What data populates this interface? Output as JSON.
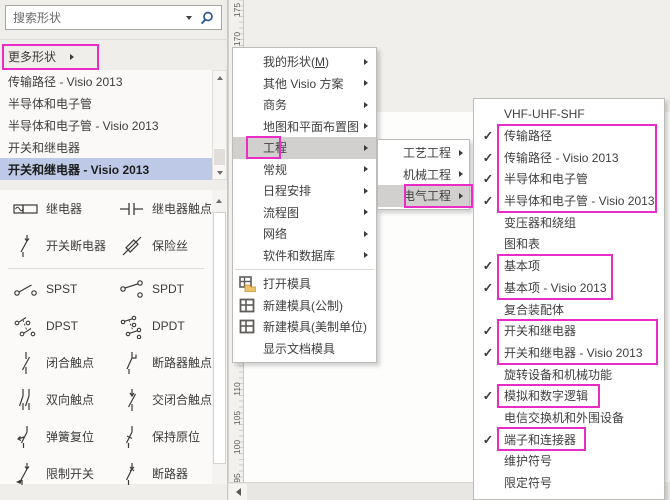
{
  "colors": {
    "annotation_magenta": "#ea2cc6",
    "selected_stencil_blue": "#bdc9e6",
    "menu_highlight_gray": "#d2d0ce",
    "search_icon_blue": "#2b579a"
  },
  "search_box": {
    "placeholder": "搜索形状"
  },
  "more_shapes_row": {
    "label": "更多形状"
  },
  "stencil_list": {
    "items": [
      {
        "label": "传输路径 - Visio 2013",
        "selected": false
      },
      {
        "label": "半导体和电子管",
        "selected": false
      },
      {
        "label": "半导体和电子管 - Visio 2013",
        "selected": false
      },
      {
        "label": "开关和继电器",
        "selected": false
      },
      {
        "label": "开关和继电器 - Visio 2013",
        "selected": true
      }
    ]
  },
  "shapes_panel": {
    "items": [
      {
        "label": "继电器",
        "icon": "relay"
      },
      {
        "label": "继电器触点",
        "icon": "relay-contact"
      },
      {
        "label": "开关断电器",
        "icon": "switch-disconnector"
      },
      {
        "label": "保险丝",
        "icon": "fuse"
      },
      {
        "label": "SPST",
        "icon": "spst-switch"
      },
      {
        "label": "SPDT",
        "icon": "spdt-switch"
      },
      {
        "label": "DPST",
        "icon": "dpst-switch"
      },
      {
        "label": "DPDT",
        "icon": "dpdt-switch"
      },
      {
        "label": "闭合触点",
        "icon": "closed-contact"
      },
      {
        "label": "断路器触点",
        "icon": "breaker-contact"
      },
      {
        "label": "双向触点",
        "icon": "two-way-contact"
      },
      {
        "label": "交闭合触点",
        "icon": "alternate-closed-contact"
      },
      {
        "label": "弹簧复位",
        "icon": "spring-return"
      },
      {
        "label": "保持原位",
        "icon": "hold-position"
      },
      {
        "label": "限制开关",
        "icon": "limit-switch"
      },
      {
        "label": "断路器",
        "icon": "circuit-breaker"
      }
    ]
  },
  "ruler": {
    "top_labels": [
      "175",
      "170"
    ],
    "bottom_labels": [
      "110",
      "105",
      "100",
      "95"
    ]
  },
  "more_shapes_menu": {
    "items": [
      {
        "label_pre": "我的形状(",
        "mnemonic": "M",
        "label_post": ")"
      },
      {
        "label": "其他 Visio 方案"
      },
      {
        "label": "商务"
      },
      {
        "label": "地图和平面布置图"
      },
      {
        "label": "工程",
        "highlighted": true
      },
      {
        "label": "常规"
      },
      {
        "label": "日程安排"
      },
      {
        "label": "流程图"
      },
      {
        "label": "网络"
      },
      {
        "label": "软件和数据库"
      },
      {
        "label": "打开模具",
        "icon": "open-stencil"
      },
      {
        "label": "新建模具(公制)",
        "icon": "new-stencil"
      },
      {
        "label": "新建模具(美制单位)",
        "icon": "new-stencil"
      },
      {
        "label": "显示文档模具"
      }
    ]
  },
  "engineering_menu": {
    "items": [
      {
        "label": "工艺工程"
      },
      {
        "label": "机械工程"
      },
      {
        "label": "电气工程",
        "highlighted": true
      }
    ]
  },
  "electrical_menu": {
    "items": [
      {
        "label": "VHF-UHF-SHF",
        "check": ""
      },
      {
        "label": "传输路径",
        "check": "✓"
      },
      {
        "label": "传输路径 - Visio 2013",
        "check": "✓"
      },
      {
        "label": "半导体和电子管",
        "check": "✓"
      },
      {
        "label": "半导体和电子管 - Visio 2013",
        "check": "✓"
      },
      {
        "label": "变压器和绕组",
        "check": ""
      },
      {
        "label": "图和表",
        "check": ""
      },
      {
        "label": "基本项",
        "check": "✓"
      },
      {
        "label": "基本项 - Visio 2013",
        "check": "✓"
      },
      {
        "label": "复合装配体",
        "check": ""
      },
      {
        "label": "开关和继电器",
        "check": "✓"
      },
      {
        "label": "开关和继电器 - Visio 2013",
        "check": "✓"
      },
      {
        "label": "旋转设备和机械功能",
        "check": ""
      },
      {
        "label": "模拟和数字逻辑",
        "check": "✓"
      },
      {
        "label": "电信交换机和外围设备",
        "check": ""
      },
      {
        "label": "端子和连接器",
        "check": "✓"
      },
      {
        "label": "维护符号",
        "check": ""
      },
      {
        "label": "限定符号",
        "check": ""
      }
    ]
  }
}
